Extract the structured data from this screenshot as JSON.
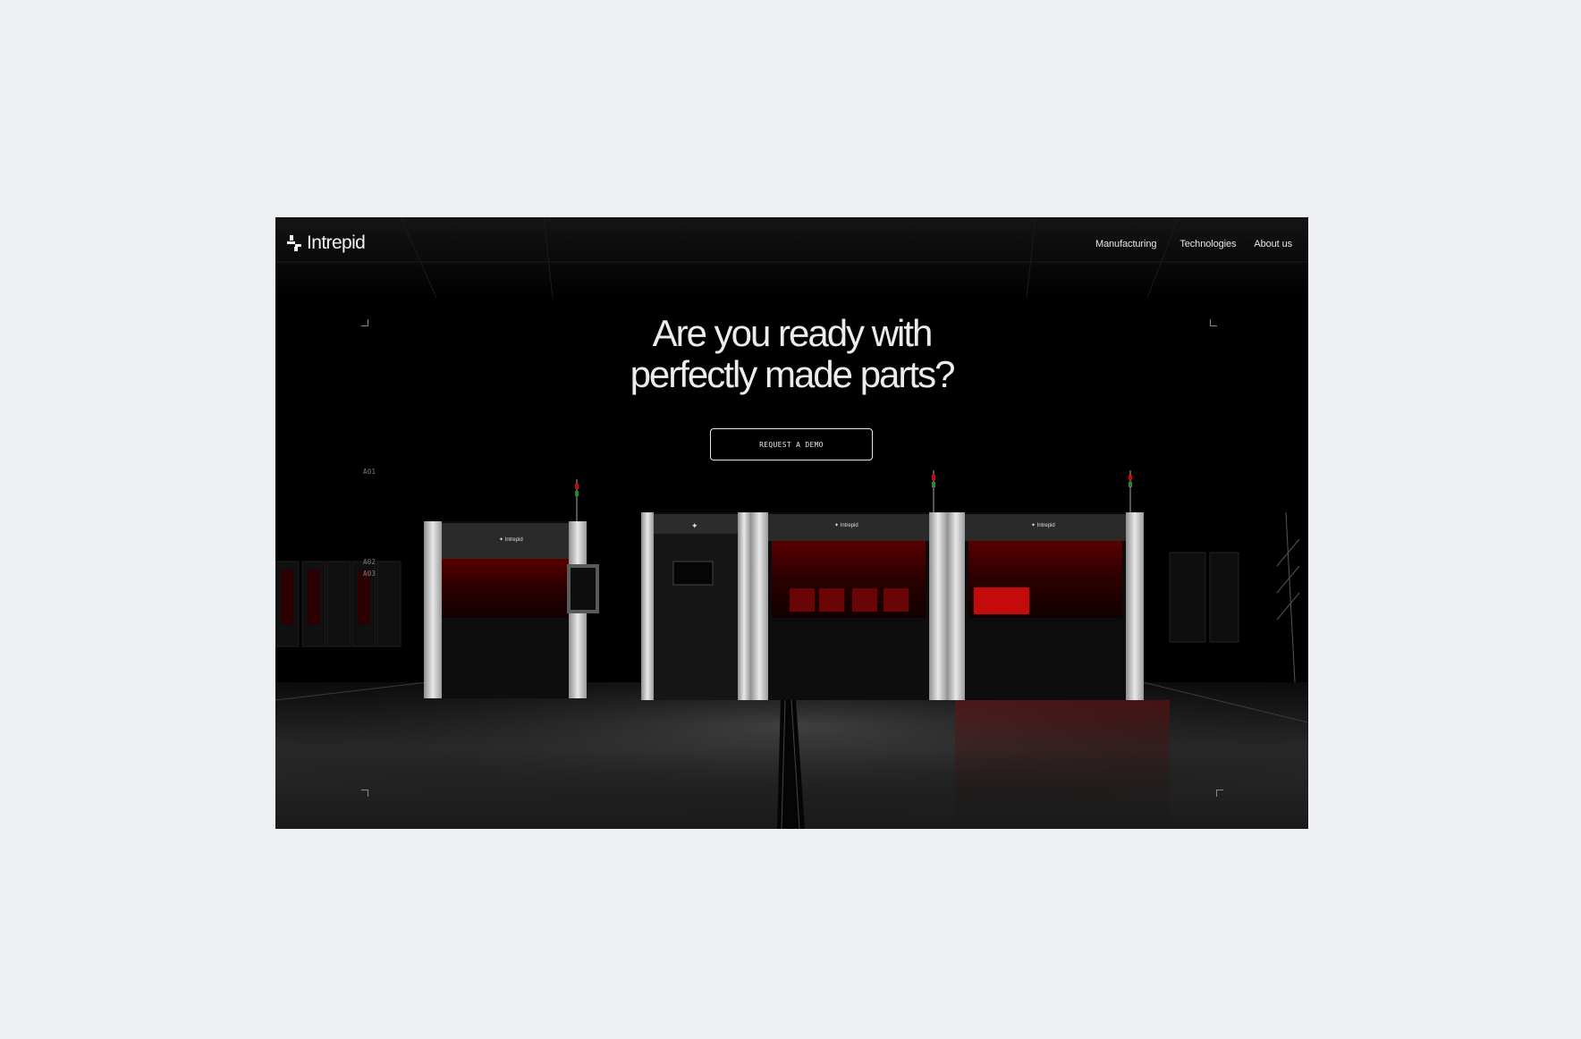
{
  "brand": {
    "name": "Intrepid",
    "logo_icon": "intrepid-logo-mark",
    "accent_color": "#c40a0a",
    "text_color": "#ececec",
    "background_color": "#000000",
    "page_background": "#edeff2"
  },
  "nav": {
    "items": [
      {
        "label": "Manufacturing"
      },
      {
        "label": "Technologies"
      },
      {
        "label": "About us"
      }
    ]
  },
  "hero": {
    "headline_line1": "Are you ready with",
    "headline_line2": "perfectly made parts?",
    "cta_label": "REQUEST A DEMO"
  },
  "scene": {
    "row_labels": [
      "A01",
      "A02",
      "A03"
    ],
    "machine_badge": "Intrepid"
  }
}
